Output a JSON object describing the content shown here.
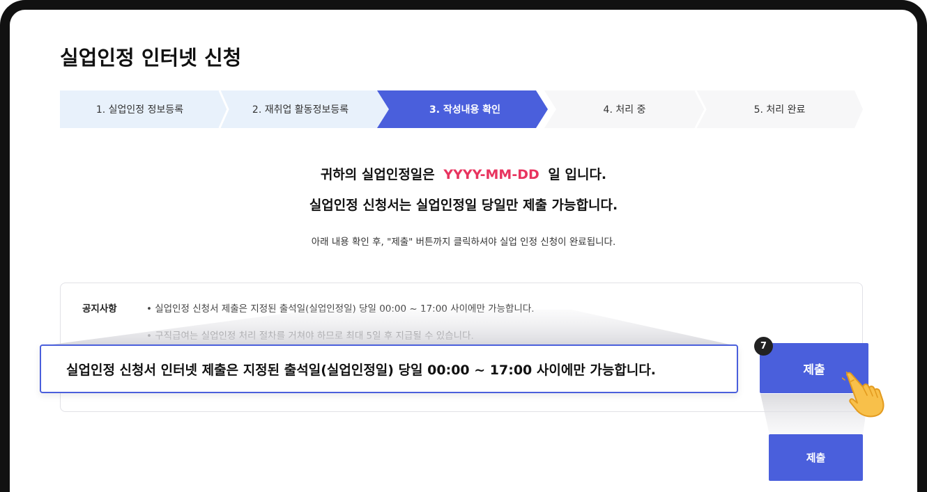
{
  "page": {
    "title": "실업인정 인터넷 신청"
  },
  "steps": [
    {
      "label": "1. 실업인정 정보등록",
      "state": "done"
    },
    {
      "label": "2. 재취업 활동정보등록",
      "state": "done"
    },
    {
      "label": "3. 작성내용 확인",
      "state": "active"
    },
    {
      "label": "4. 처리 중",
      "state": "todo"
    },
    {
      "label": "5. 처리 완료",
      "state": "todo"
    }
  ],
  "message": {
    "line1_prefix": "귀하의 실업인정일은",
    "date": "YYYY-MM-DD",
    "line1_suffix": "일 입니다.",
    "line2": "실업인정 신청서는 실업인정일 당일만 제출 가능합니다.",
    "instruction": "아래 내용 확인 후, \"제출\" 버튼까지 클릭하셔야 실업 인정 신청이 완료됩니다."
  },
  "notice": {
    "label": "공지사항",
    "items": [
      "• 실업인정 신청서 제출은 지정된 출석일(실업인정일) 당일 00:00 ~ 17:00 사이에만 가능합니다.",
      "• 구직급여는 실업인정 처리 절차를 거쳐야 하므로 최대 5일 후 지급될 수 있습니다."
    ]
  },
  "callout": {
    "text": "실업인정 신청서 인터넷 제출은 지정된 출석일(실업인정일) 당일 00:00 ~ 17:00 사이에만 가능합니다."
  },
  "submit": {
    "label": "제출",
    "badge": "7",
    "small_label": "제출"
  },
  "colors": {
    "accent": "#4a5fdc",
    "date_highlight": "#e8345f",
    "step_done_bg": "#e8f1fb",
    "step_todo_bg": "#f7f7f8"
  }
}
